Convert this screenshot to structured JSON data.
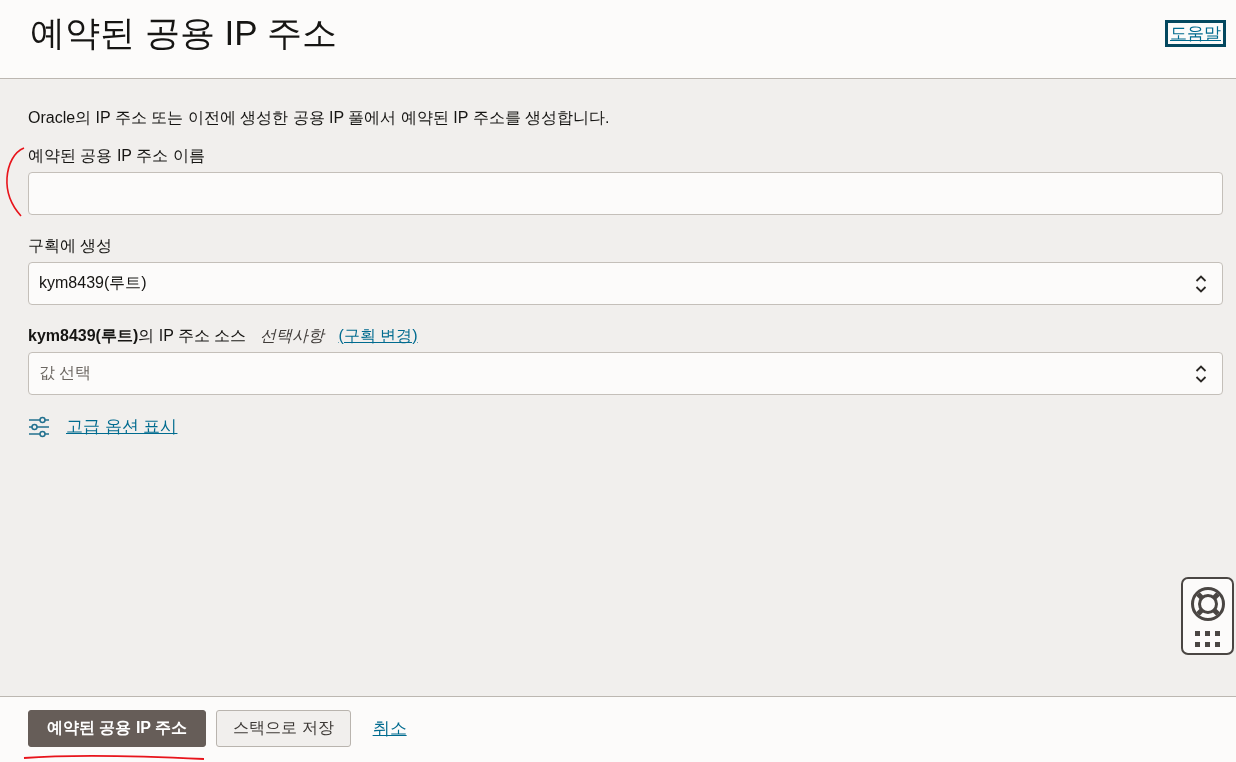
{
  "header": {
    "title": "예약된 공용 IP 주소",
    "help_link": {
      "label": "도움말",
      "focused": true
    }
  },
  "form": {
    "description": "Oracle의 IP 주소 또는 이전에 생성한 공용 IP 풀에서 예약된 IP 주소를 생성합니다.",
    "fields": [
      {
        "kind": "text",
        "label": "예약된 공용 IP 주소 이름"
      },
      {
        "kind": "select",
        "label": "구획에 생성",
        "value": "kym8439(루트)"
      },
      {
        "kind": "select",
        "label": "**kym8439(루트)**의 IP 주소 소스",
        "optional_note": "선택사항",
        "link": "(구획 변경)",
        "placeholder": "값 선택"
      }
    ],
    "advanced_link": "고급 옵션 표시"
  },
  "footer": {
    "buttons": [
      {
        "kind": "primary",
        "label": "예약된 공용 IP 주소"
      },
      {
        "kind": "secondary",
        "label": "스택으로 저장"
      },
      {
        "kind": "link",
        "label": "취소"
      }
    ]
  }
}
